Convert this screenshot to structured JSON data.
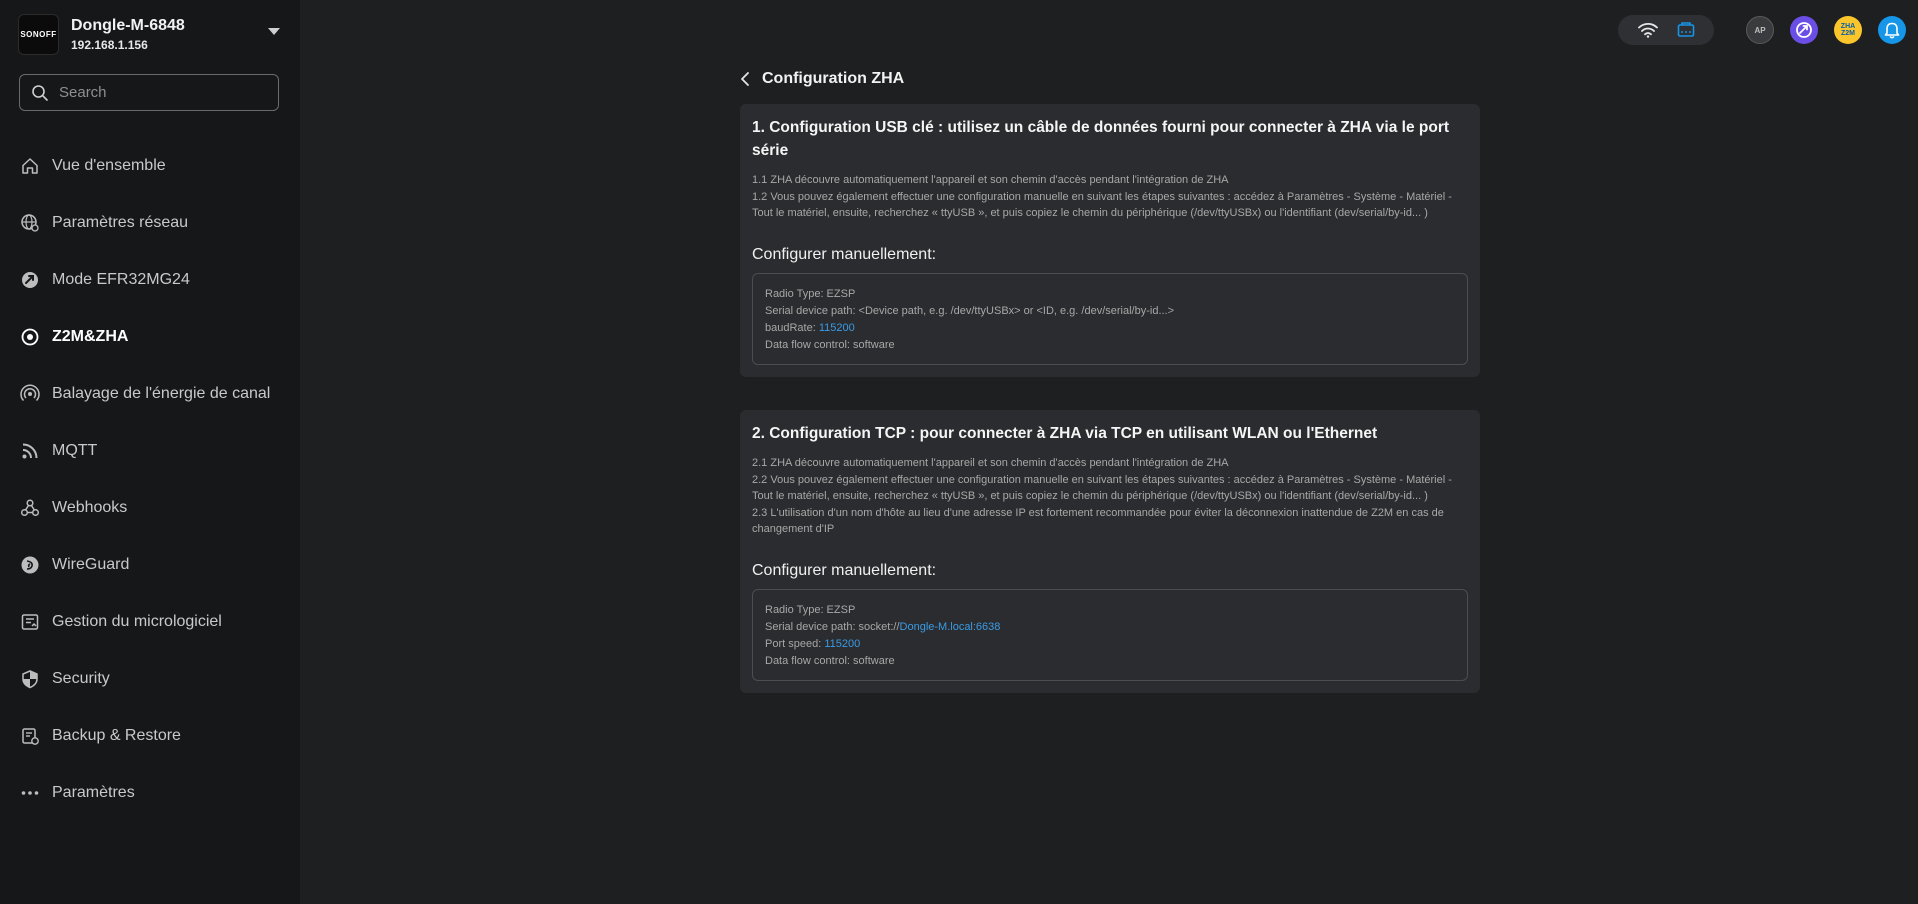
{
  "device": {
    "logo_text": "SONOFF",
    "name": "Dongle-M-6848",
    "ip": "192.168.1.156"
  },
  "search": {
    "placeholder": "Search"
  },
  "sidebar": {
    "items": [
      {
        "label": "Vue d'ensemble",
        "icon": "home-icon"
      },
      {
        "label": "Paramètres réseau",
        "icon": "globe-icon"
      },
      {
        "label": "Mode EFR32MG24",
        "icon": "efr-mode-icon"
      },
      {
        "label": "Z2M&ZHA",
        "icon": "z2m-zha-icon",
        "active": true
      },
      {
        "label": "Balayage de l'énergie de canal",
        "icon": "signal-scan-icon"
      },
      {
        "label": "MQTT",
        "icon": "rss-icon"
      },
      {
        "label": "Webhooks",
        "icon": "webhook-icon"
      },
      {
        "label": "WireGuard",
        "icon": "wireguard-icon"
      },
      {
        "label": "Gestion du micrologiciel",
        "icon": "firmware-icon"
      },
      {
        "label": "Security",
        "icon": "shield-icon"
      },
      {
        "label": "Backup & Restore",
        "icon": "backup-icon"
      },
      {
        "label": "Paramètres",
        "icon": "more-dots-icon"
      }
    ]
  },
  "topbar": {
    "ap_label": "AP",
    "zha_label_top": "ZHA",
    "zha_label_bottom": "Z2M"
  },
  "colors": {
    "accent_blue": "#1696e8",
    "link_blue": "#3a9be5",
    "z2m_purple": "#6b4ee6",
    "zha_yellow": "#fbc52c"
  },
  "page": {
    "title": "Configuration ZHA"
  },
  "usb_card": {
    "title": "1. Configuration USB clé : utilisez un câble de données fourni pour connecter à ZHA via le port série",
    "desc": [
      "1.1 ZHA découvre automatiquement l'appareil et son chemin d'accès pendant l'intégration de ZHA",
      "1.2 Vous pouvez également effectuer une configuration manuelle en suivant les étapes suivantes : accédez à Paramètres - Système - Matériel - Tout le matériel, ensuite, recherchez « ttyUSB », et puis copiez le chemin du périphérique (/dev/ttyUSBx) ou l'identifiant (dev/serial/by-id... )"
    ],
    "manual_title": "Configurer manuellement:",
    "radio_type": "Radio Type: EZSP",
    "serial_path": "Serial device path: <Device path, e.g. /dev/ttyUSBx> or <ID, e.g. /dev/serial/by-id...>",
    "baud_label": "baudRate: ",
    "baud_value": "115200",
    "flow_control": "Data flow control: software"
  },
  "tcp_card": {
    "title": "2. Configuration TCP : pour connecter à ZHA via TCP en utilisant WLAN ou l'Ethernet",
    "desc": [
      "2.1 ZHA découvre automatiquement l'appareil et son chemin d'accès pendant l'intégration de ZHA",
      "2.2 Vous pouvez également effectuer une configuration manuelle en suivant les étapes suivantes : accédez à Paramètres - Système - Matériel - Tout le matériel, ensuite, recherchez « ttyUSB », et puis copiez le chemin du périphérique (/dev/ttyUSBx) ou l'identifiant (dev/serial/by-id... )",
      "2.3 L'utilisation d'un nom d'hôte au lieu d'une adresse IP est fortement recommandée pour éviter la déconnexion inattendue de Z2M en cas de changement d'IP"
    ],
    "manual_title": "Configurer manuellement:",
    "radio_type": "Radio Type: EZSP",
    "serial_label": "Serial device path: socket://",
    "serial_value": "Dongle-M.local:6638",
    "port_label": "Port speed: ",
    "port_value": "115200",
    "flow_control": "Data flow control: software"
  }
}
